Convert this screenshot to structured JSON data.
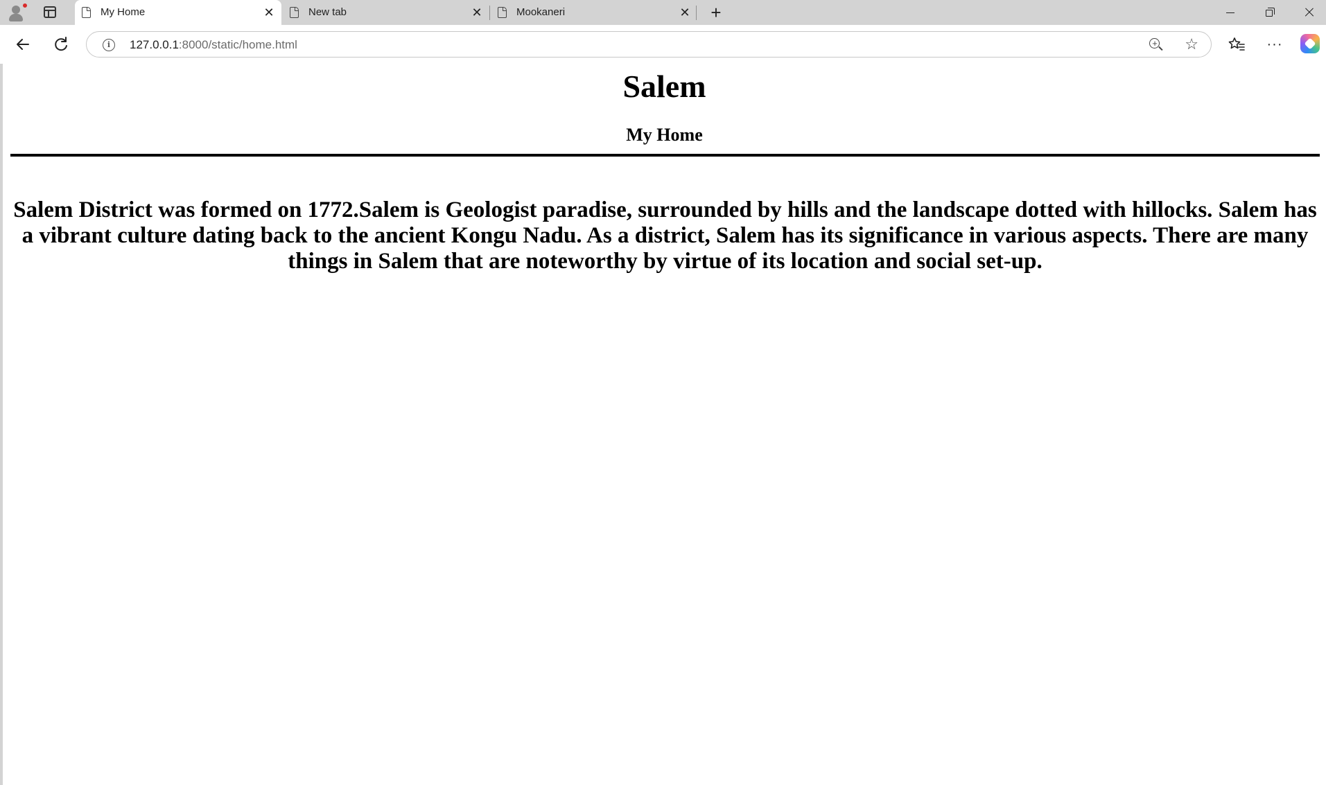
{
  "browser": {
    "tabs": [
      {
        "title": "My Home",
        "active": true
      },
      {
        "title": "New tab",
        "active": false
      },
      {
        "title": "Mookaneri",
        "active": false
      }
    ],
    "address_bar": {
      "host": "127.0.0.1",
      "path": ":8000/static/home.html"
    },
    "icons": {
      "profile": "profile-avatar-icon",
      "sidebar": "sidebar-toggle-icon",
      "new_tab": "plus-icon",
      "back": "back-arrow-icon",
      "reload": "reload-icon",
      "info": "site-info-icon",
      "zoom": "zoom-in-icon",
      "favorite": "star-icon",
      "favorites": "favorites-icon",
      "menu": "more-icon",
      "copilot": "copilot-icon"
    }
  },
  "page": {
    "title": "Salem",
    "subtitle": "My Home",
    "body": "Salem District was formed on 1772.Salem is Geologist paradise, surrounded by hills and the landscape dotted with hillocks. Salem has a vibrant culture dating back to the ancient Kongu Nadu. As a district, Salem has its significance in various aspects. There are many things in Salem that are noteworthy by virtue of its location and social set-up."
  }
}
